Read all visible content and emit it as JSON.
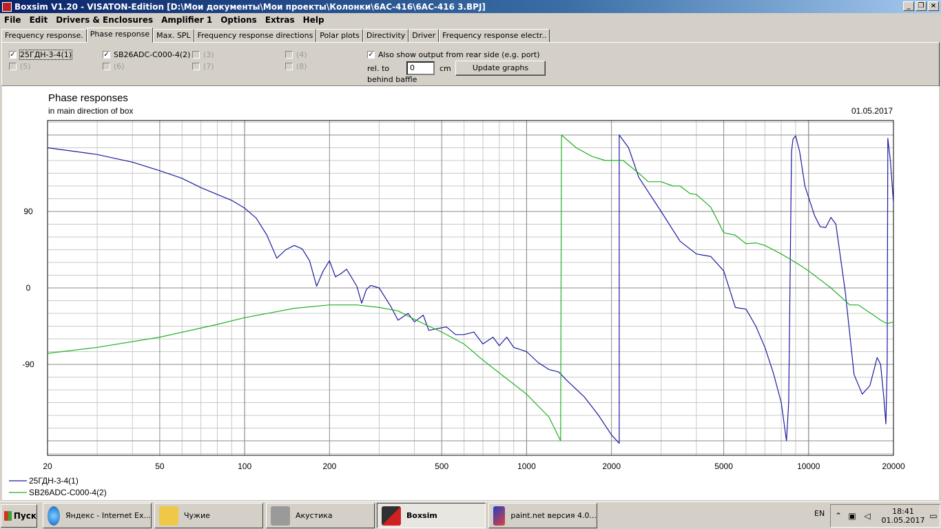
{
  "window": {
    "title": "Boxsim V1.20 - VISATON-Edition [D:\\Мои документы\\Мои проекты\\Колонки\\6АС-416\\6АС-416 3.BPJ]"
  },
  "menu": [
    "File",
    "Edit",
    "Drivers & Enclosures",
    "Amplifier 1",
    "Options",
    "Extras",
    "Help"
  ],
  "tabs": [
    "Frequency response.",
    "Phase response",
    "Max. SPL",
    "Frequency response directions",
    "Polar plots",
    "Directivity",
    "Driver",
    "Frequency response electr.."
  ],
  "active_tab": 1,
  "drivers": [
    {
      "label": "25ГДН-3-4(1)",
      "checked": true,
      "enabled": true
    },
    {
      "label": "SB26ADC-C000-4(2)",
      "checked": true,
      "enabled": true
    },
    {
      "label": "(3)",
      "checked": false,
      "enabled": false
    },
    {
      "label": "(4)",
      "checked": false,
      "enabled": false
    },
    {
      "label": "(5)",
      "checked": false,
      "enabled": false
    },
    {
      "label": "(6)",
      "checked": false,
      "enabled": false
    },
    {
      "label": "(7)",
      "checked": false,
      "enabled": false
    },
    {
      "label": "(8)",
      "checked": false,
      "enabled": false
    }
  ],
  "options": {
    "rear_output_label": "Also show output from rear side (e.g. port)",
    "rear_output_checked": true,
    "rel_to_label": "rel. to",
    "behind_baffle_label": "behind baffle",
    "offset_value": "0",
    "offset_unit": "cm",
    "update_label": "Update graphs"
  },
  "graph": {
    "title": "Phase responses",
    "subtitle": "in main direction of box",
    "date": "01.05.2017"
  },
  "chart_data": {
    "type": "line",
    "title": "Phase responses",
    "subtitle": "in main direction of box",
    "xscale": "log",
    "xlim": [
      20,
      20000
    ],
    "ylim": [
      -197,
      197
    ],
    "x_tick_labels": [
      "20",
      "50",
      "100",
      "200",
      "500",
      "1000",
      "2000",
      "5000",
      "10000",
      "20000"
    ],
    "y_tick_labels": [
      "90",
      "0",
      "-90"
    ],
    "grid": true,
    "legend": "bottom-left",
    "series": [
      {
        "name": "25ГДН-3-4(1)",
        "color": "#1a1aa0",
        "points": [
          [
            20,
            165
          ],
          [
            30,
            157
          ],
          [
            40,
            148
          ],
          [
            50,
            138
          ],
          [
            60,
            129
          ],
          [
            70,
            118
          ],
          [
            80,
            110
          ],
          [
            90,
            103
          ],
          [
            100,
            94
          ],
          [
            110,
            82
          ],
          [
            120,
            62
          ],
          [
            130,
            35
          ],
          [
            140,
            45
          ],
          [
            150,
            50
          ],
          [
            160,
            46
          ],
          [
            170,
            32
          ],
          [
            180,
            2
          ],
          [
            190,
            20
          ],
          [
            200,
            32
          ],
          [
            210,
            13
          ],
          [
            220,
            17
          ],
          [
            230,
            22
          ],
          [
            250,
            2
          ],
          [
            260,
            -18
          ],
          [
            270,
            -2
          ],
          [
            280,
            3
          ],
          [
            300,
            0
          ],
          [
            330,
            -22
          ],
          [
            350,
            -38
          ],
          [
            380,
            -30
          ],
          [
            400,
            -40
          ],
          [
            430,
            -32
          ],
          [
            450,
            -50
          ],
          [
            480,
            -48
          ],
          [
            520,
            -46
          ],
          [
            560,
            -55
          ],
          [
            600,
            -55
          ],
          [
            650,
            -52
          ],
          [
            700,
            -66
          ],
          [
            760,
            -58
          ],
          [
            800,
            -68
          ],
          [
            850,
            -58
          ],
          [
            900,
            -70
          ],
          [
            1000,
            -75
          ],
          [
            1100,
            -88
          ],
          [
            1200,
            -96
          ],
          [
            1300,
            -99
          ],
          [
            1400,
            -110
          ],
          [
            1600,
            -128
          ],
          [
            1800,
            -150
          ],
          [
            2000,
            -173
          ],
          [
            2130,
            -183
          ],
          [
            2131,
            180
          ],
          [
            2300,
            165
          ],
          [
            2500,
            130
          ],
          [
            3000,
            90
          ],
          [
            3500,
            55
          ],
          [
            4000,
            40
          ],
          [
            4500,
            37
          ],
          [
            5000,
            20
          ],
          [
            5500,
            -23
          ],
          [
            6000,
            -25
          ],
          [
            6500,
            -45
          ],
          [
            7000,
            -70
          ],
          [
            7500,
            -100
          ],
          [
            8000,
            -135
          ],
          [
            8350,
            -180
          ],
          [
            8500,
            -135
          ],
          [
            8700,
            160
          ],
          [
            8800,
            175
          ],
          [
            9000,
            179
          ],
          [
            9300,
            160
          ],
          [
            9700,
            120
          ],
          [
            10500,
            85
          ],
          [
            11000,
            72
          ],
          [
            11500,
            71
          ],
          [
            12000,
            83
          ],
          [
            12500,
            75
          ],
          [
            13500,
            -5
          ],
          [
            14500,
            -102
          ],
          [
            15500,
            -125
          ],
          [
            16500,
            -115
          ],
          [
            17500,
            -82
          ],
          [
            18000,
            -90
          ],
          [
            18500,
            -130
          ],
          [
            18800,
            -160
          ],
          [
            19000,
            -90
          ],
          [
            19100,
            176
          ],
          [
            19500,
            150
          ],
          [
            20000,
            100
          ]
        ]
      },
      {
        "name": "SB26ADC-C000-4(2)",
        "color": "#20b020",
        "points": [
          [
            20,
            -77
          ],
          [
            30,
            -70
          ],
          [
            50,
            -58
          ],
          [
            80,
            -43
          ],
          [
            100,
            -35
          ],
          [
            150,
            -24
          ],
          [
            200,
            -20
          ],
          [
            250,
            -20
          ],
          [
            300,
            -23
          ],
          [
            350,
            -27
          ],
          [
            400,
            -37
          ],
          [
            450,
            -45
          ],
          [
            500,
            -52
          ],
          [
            600,
            -66
          ],
          [
            700,
            -85
          ],
          [
            800,
            -100
          ],
          [
            1000,
            -125
          ],
          [
            1200,
            -152
          ],
          [
            1320,
            -180
          ],
          [
            1330,
            180
          ],
          [
            1500,
            165
          ],
          [
            1700,
            155
          ],
          [
            1900,
            150
          ],
          [
            2000,
            150
          ],
          [
            2200,
            150
          ],
          [
            2500,
            135
          ],
          [
            2700,
            125
          ],
          [
            3000,
            125
          ],
          [
            3300,
            120
          ],
          [
            3500,
            120
          ],
          [
            3800,
            111
          ],
          [
            4000,
            110
          ],
          [
            4500,
            95
          ],
          [
            5000,
            65
          ],
          [
            5500,
            62
          ],
          [
            6000,
            52
          ],
          [
            6500,
            53
          ],
          [
            7000,
            50
          ],
          [
            8000,
            40
          ],
          [
            9000,
            30
          ],
          [
            10000,
            20
          ],
          [
            12000,
            0
          ],
          [
            14000,
            -20
          ],
          [
            15000,
            -20
          ],
          [
            17000,
            -32
          ],
          [
            18000,
            -38
          ],
          [
            19000,
            -42
          ],
          [
            20000,
            -40
          ]
        ]
      }
    ]
  },
  "taskbar": {
    "start_label": "Пуск",
    "tasks": [
      "Яндекс - Internet Ex...",
      "Чужие",
      "Акустика",
      "Boxsim",
      "paint.net версия 4.0..."
    ],
    "active_task": 3,
    "lang": "EN",
    "time": "18:41",
    "date": "01.05.2017"
  }
}
